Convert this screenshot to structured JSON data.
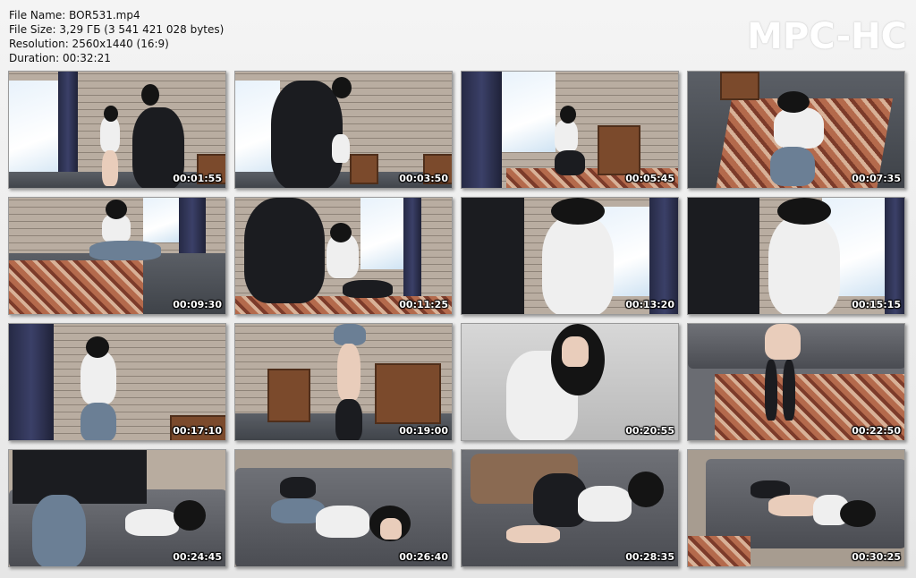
{
  "info": {
    "file_name": "File Name: BOR531.mp4",
    "file_size": "File Size: 3,29 ГБ (3 541 421 028 bytes)",
    "resolution": "Resolution: 2560x1440 (16:9)",
    "duration": "Duration: 00:32:21"
  },
  "brand": "MPC-HC",
  "thumbnails": [
    {
      "time": "00:01:55",
      "scene": "room"
    },
    {
      "time": "00:03:50",
      "scene": "room"
    },
    {
      "time": "00:05:45",
      "scene": "room"
    },
    {
      "time": "00:07:35",
      "scene": "rug"
    },
    {
      "time": "00:09:30",
      "scene": "rug"
    },
    {
      "time": "00:11:25",
      "scene": "room"
    },
    {
      "time": "00:13:20",
      "scene": "closeup"
    },
    {
      "time": "00:15:15",
      "scene": "closeup"
    },
    {
      "time": "00:17:10",
      "scene": "room"
    },
    {
      "time": "00:19:00",
      "scene": "room"
    },
    {
      "time": "00:20:55",
      "scene": "closeup"
    },
    {
      "time": "00:22:50",
      "scene": "rug"
    },
    {
      "time": "00:24:45",
      "scene": "sofa"
    },
    {
      "time": "00:26:40",
      "scene": "sofa"
    },
    {
      "time": "00:28:35",
      "scene": "sofa"
    },
    {
      "time": "00:30:25",
      "scene": "sofa"
    }
  ]
}
